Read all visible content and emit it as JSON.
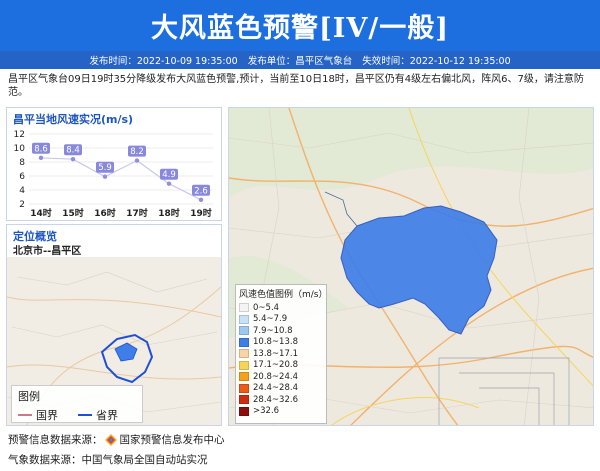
{
  "header": {
    "title": "大风蓝色预警[IV/一般]"
  },
  "meta": {
    "publish_time": "发布时间：2022-10-09 19:35:00",
    "publisher": "发布单位：昌平区气象台",
    "expire_time": "失效时间：2022-10-12 19:35:00"
  },
  "description": "昌平区气象台09日19时35分降级发布大风蓝色预警,预计，当前至10日18时，昌平区仍有4级左右偏北风，阵风6、7级，请注意防范。",
  "wind_panel": {
    "title": "昌平当地风速实况(m/s)"
  },
  "chart_data": {
    "type": "line",
    "title": "昌平当地风速实况(m/s)",
    "categories": [
      "14时",
      "15时",
      "16时",
      "17时",
      "18时",
      "19时"
    ],
    "values": [
      8.6,
      8.4,
      5.9,
      8.2,
      4.9,
      2.6
    ],
    "data_labels": [
      "8.6",
      "8.4",
      "5.9",
      "8.2",
      "4.9",
      "2.6"
    ],
    "ylim": [
      2,
      12
    ],
    "yticks": [
      "2",
      "4",
      "6",
      "8",
      "10",
      "12"
    ],
    "grid": true,
    "color": "#8f8ee0",
    "label_color": "#8888dd"
  },
  "location": {
    "title": "定位概览",
    "subtitle": "北京市--昌平区",
    "legend_title": "图例",
    "legend_items": [
      {
        "label": "国界",
        "color": "#c77a8c"
      },
      {
        "label": "省界",
        "color": "#1f4fd6"
      }
    ]
  },
  "wind_legend": {
    "title": "风速色值图例（m/s）",
    "items": [
      {
        "label": "0~5.4",
        "color": "#f4f4f4"
      },
      {
        "label": "5.4~7.9",
        "color": "#c6e2f7"
      },
      {
        "label": "7.9~10.8",
        "color": "#9dc8f0"
      },
      {
        "label": "10.8~13.8",
        "color": "#3f7ee8"
      },
      {
        "label": "13.8~17.1",
        "color": "#f7d3a6"
      },
      {
        "label": "17.1~20.8",
        "color": "#f6d65a"
      },
      {
        "label": "20.8~24.4",
        "color": "#f4a21c"
      },
      {
        "label": "24.4~28.4",
        "color": "#ee5a17"
      },
      {
        "label": "28.4~32.6",
        "color": "#cf2a12"
      },
      {
        "label": ">32.6",
        "color": "#8a0e0e"
      }
    ]
  },
  "footer": {
    "warning_source_label": "预警信息数据来源：",
    "warning_source_name": "国家预警信息发布中心",
    "weather_source": "气象数据来源：中国气象局全国自动站实况"
  },
  "colors": {
    "header_bg": "#1d6fe0",
    "meta_bg": "#2563c7",
    "region_fill": "#3f7ee8"
  }
}
